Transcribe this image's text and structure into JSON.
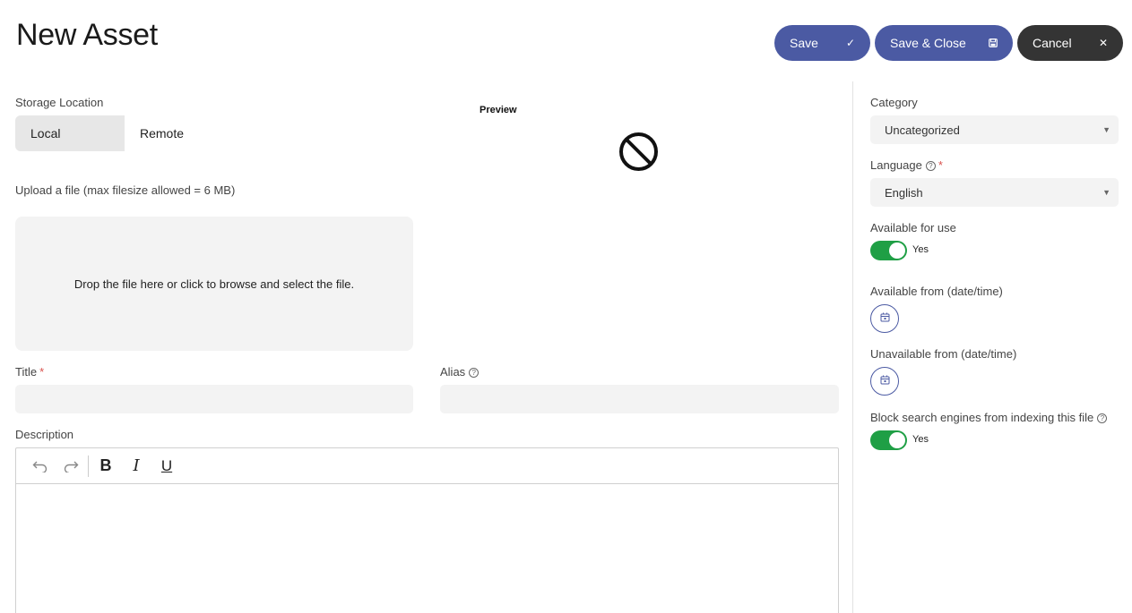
{
  "page": {
    "title": "New Asset"
  },
  "toolbar": {
    "save_label": "Save",
    "save_close_label": "Save & Close",
    "cancel_label": "Cancel",
    "primary_color": "#4b5aa3",
    "dark_color": "#343434"
  },
  "storage": {
    "label": "Storage Location",
    "options": [
      "Local",
      "Remote"
    ],
    "selected": "Local"
  },
  "preview": {
    "label": "Preview",
    "icon": "no-preview-icon"
  },
  "upload": {
    "label": "Upload a file (max filesize allowed = 6 MB)",
    "dropzone_text": "Drop the file here or click to browse and select the file."
  },
  "fields": {
    "title_label": "Title",
    "title_required": "*",
    "title_value": "",
    "alias_label": "Alias",
    "alias_value": "",
    "description_label": "Description"
  },
  "editor": {
    "buttons": [
      "undo-icon",
      "redo-icon",
      "bold-icon",
      "italic-icon",
      "underline-icon"
    ]
  },
  "sidebar": {
    "category_label": "Category",
    "category_value": "Uncategorized",
    "language_label": "Language",
    "language_required": "*",
    "language_value": "English",
    "available_label": "Available for use",
    "available_value": "Yes",
    "available_from_label": "Available from (date/time)",
    "unavailable_from_label": "Unavailable from (date/time)",
    "block_label": "Block search engines from indexing this file",
    "block_value": "Yes",
    "toggle_color": "#1f9f45"
  }
}
